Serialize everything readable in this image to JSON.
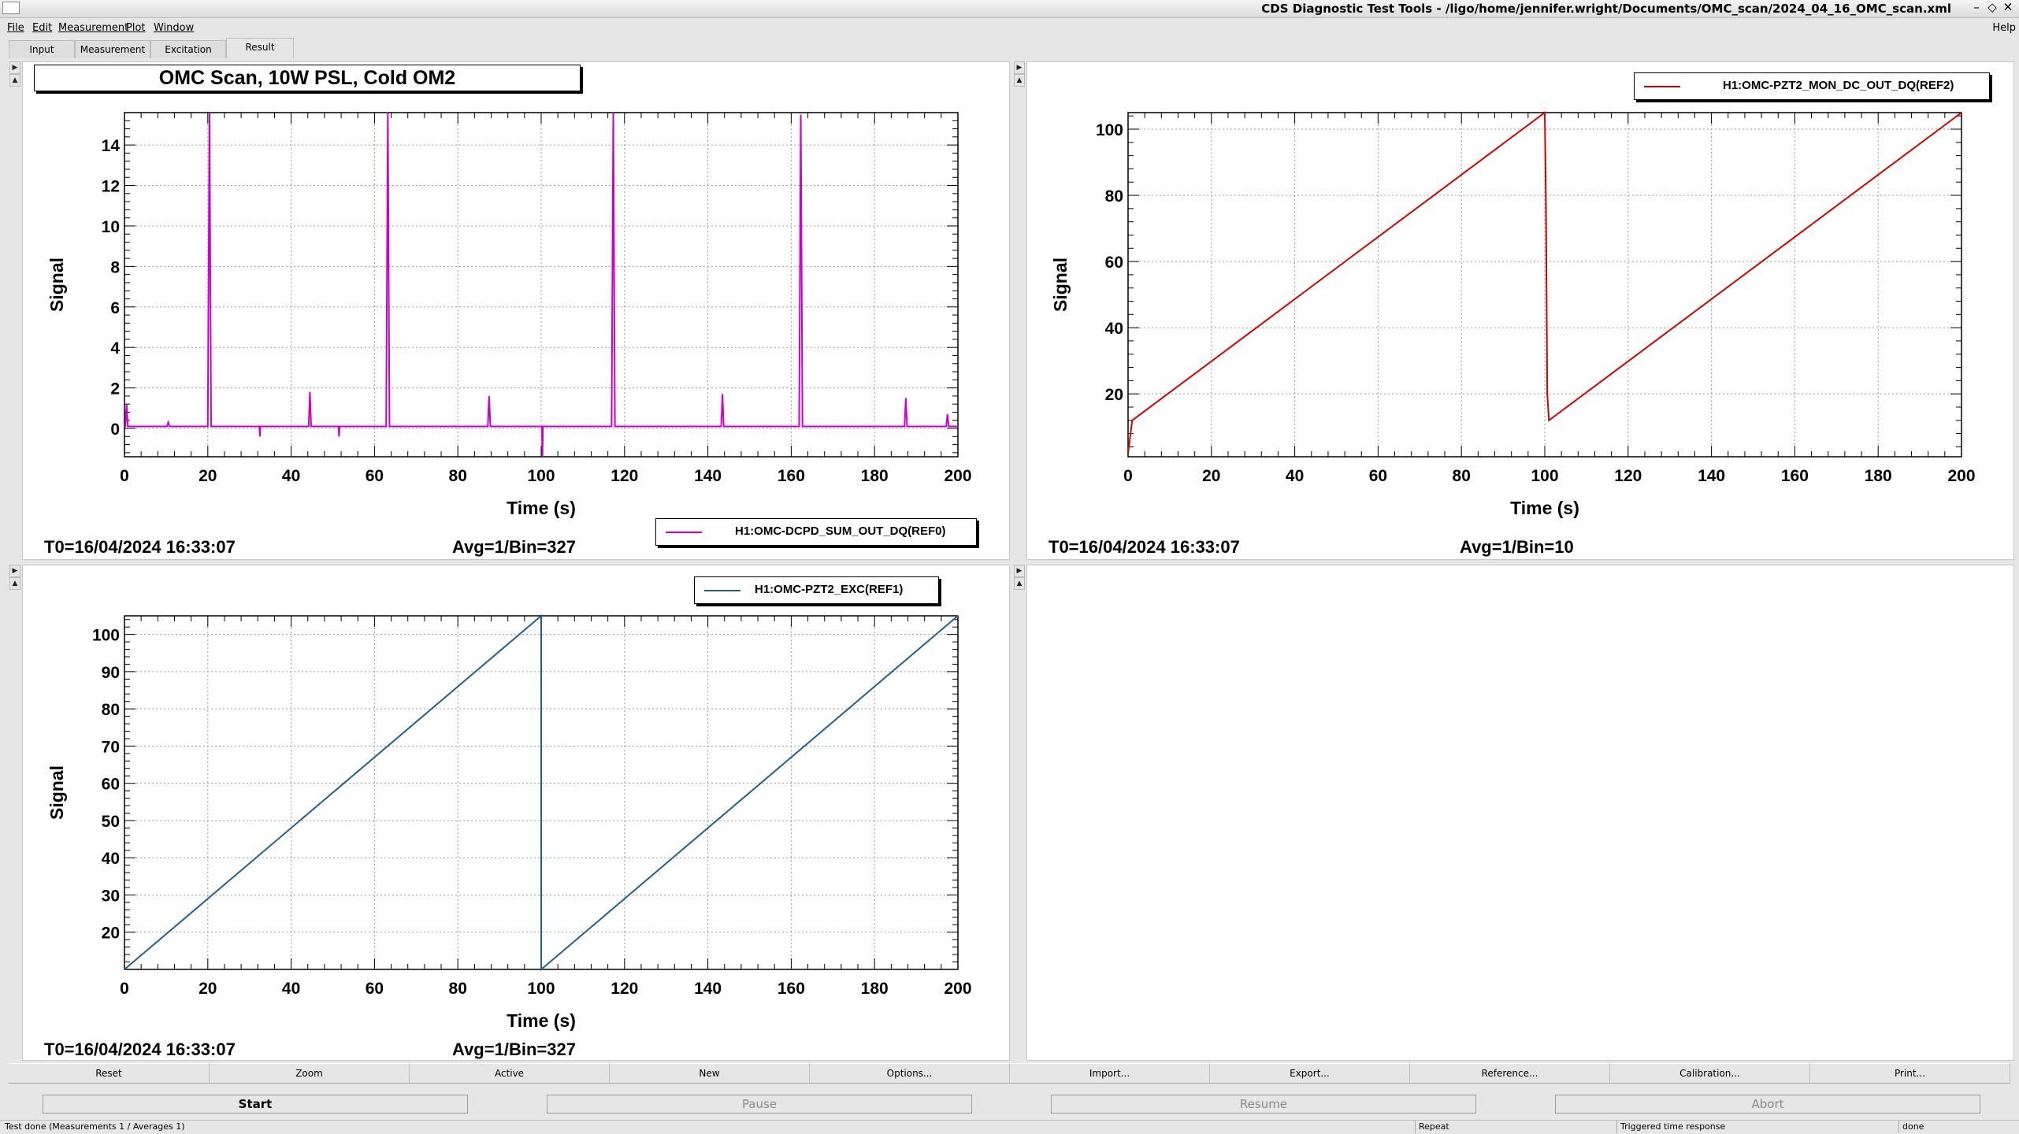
{
  "window": {
    "title": "CDS Diagnostic Test Tools - /ligo/home/jennifer.wright/Documents/OMC_scan/2024_04_16_OMC_scan.xml",
    "controls": [
      "–",
      "◇",
      "✕"
    ]
  },
  "menu": {
    "items": [
      "File",
      "Edit",
      "Measurement",
      "Plot",
      "Window"
    ],
    "help": "Help"
  },
  "tabs": [
    "Input",
    "Measurement",
    "Excitation",
    "Result"
  ],
  "active_tab": "Result",
  "plots": {
    "p1": {
      "title": "OMC Scan, 10W PSL, Cold OM2",
      "legend": "H1:OMC-DCPD_SUM_OUT_DQ(REF0)",
      "t0": "T0=16/04/2024 16:33:07",
      "avg": "Avg=1/Bin=327"
    },
    "p2": {
      "legend": "H1:OMC-PZT2_MON_DC_OUT_DQ(REF2)",
      "t0": "T0=16/04/2024 16:33:07",
      "avg": "Avg=1/Bin=10"
    },
    "p3": {
      "legend": "H1:OMC-PZT2_EXC(REF1)",
      "t0": "T0=16/04/2024 16:33:07",
      "avg": "Avg=1/Bin=327"
    }
  },
  "chart_data": [
    {
      "type": "line",
      "title": "OMC Scan, 10W PSL, Cold OM2",
      "xlabel": "Time (s)",
      "ylabel": "Signal",
      "xlim": [
        0,
        200
      ],
      "ylim": [
        -1.4,
        15.6
      ],
      "xticks": [
        0,
        20,
        40,
        60,
        80,
        100,
        120,
        140,
        160,
        180,
        200
      ],
      "yticks": [
        0,
        2,
        4,
        6,
        8,
        10,
        12,
        14
      ],
      "grid": true,
      "legend_position": "bottom-right",
      "color": "#cc00cc",
      "series": [
        {
          "name": "H1:OMC-DCPD_SUM_OUT_DQ(REF0)",
          "baseline": 0.1,
          "peaks": [
            {
              "x": 0.5,
              "y": 1.2
            },
            {
              "x": 10.5,
              "y": 0.3
            },
            {
              "x": 20.4,
              "y": 15.6
            },
            {
              "x": 44.5,
              "y": 1.8
            },
            {
              "x": 63.2,
              "y": 15.6
            },
            {
              "x": 87.5,
              "y": 1.6
            },
            {
              "x": 117.3,
              "y": 15.6
            },
            {
              "x": 143.5,
              "y": 1.7
            },
            {
              "x": 162.3,
              "y": 15.5
            },
            {
              "x": 187.5,
              "y": 1.5
            },
            {
              "x": 197.5,
              "y": 0.7
            }
          ],
          "dips": [
            {
              "x": 32.5,
              "y": -0.4
            },
            {
              "x": 51.5,
              "y": -0.4
            },
            {
              "x": 100.3,
              "y": -1.4
            }
          ]
        }
      ]
    },
    {
      "type": "line",
      "xlabel": "Time (s)",
      "ylabel": "Signal",
      "xlim": [
        0,
        200
      ],
      "ylim": [
        1,
        105
      ],
      "xticks": [
        0,
        20,
        40,
        60,
        80,
        100,
        120,
        140,
        160,
        180,
        200
      ],
      "yticks": [
        20,
        40,
        60,
        80,
        100
      ],
      "grid": true,
      "legend_position": "top-right",
      "color": "#d40000",
      "series": [
        {
          "name": "H1:OMC-PZT2_MON_DC_OUT_DQ(REF2)",
          "x": [
            0,
            1,
            100,
            100.3,
            100.6,
            101,
            200
          ],
          "y": [
            2,
            12,
            105,
            75,
            20,
            12,
            105
          ]
        }
      ]
    },
    {
      "type": "line",
      "xlabel": "Time (s)",
      "ylabel": "Signal",
      "xlim": [
        0,
        200
      ],
      "ylim": [
        10,
        105
      ],
      "xticks": [
        0,
        20,
        40,
        60,
        80,
        100,
        120,
        140,
        160,
        180,
        200
      ],
      "yticks": [
        20,
        30,
        40,
        50,
        60,
        70,
        80,
        90,
        100
      ],
      "grid": true,
      "legend_position": "top-right",
      "color": "#1f5f8f",
      "series": [
        {
          "name": "H1:OMC-PZT2_EXC(REF1)",
          "x": [
            0,
            100,
            100.01,
            200
          ],
          "y": [
            10,
            105,
            10,
            105
          ]
        }
      ]
    }
  ],
  "buttons": [
    "Reset",
    "Zoom",
    "Active",
    "New",
    "Options...",
    "Import...",
    "Export...",
    "Reference...",
    "Calibration...",
    "Print..."
  ],
  "controls": {
    "start": "Start",
    "pause": "Pause",
    "resume": "Resume",
    "abort": "Abort"
  },
  "status": {
    "message": "Test done (Measurements 1 / Averages 1)",
    "repeat": "Repeat",
    "mode": "Triggered time response",
    "state": "done"
  }
}
